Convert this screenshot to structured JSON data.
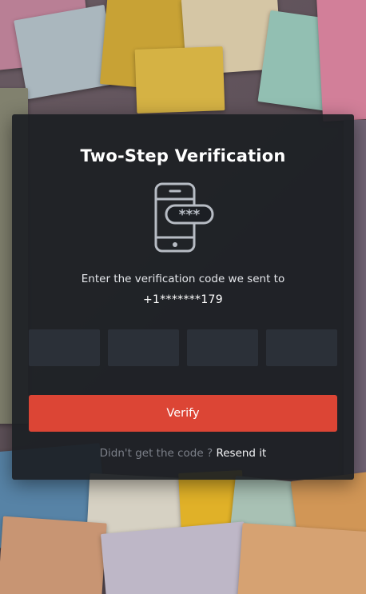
{
  "dialog": {
    "title": "Two-Step Verification",
    "phone_icon": "smartphone-password-icon",
    "phone_icon_text": "***",
    "instruction": "Enter the verification code we sent to",
    "phone_number": "+1*******179",
    "code_inputs": [
      {
        "value": "",
        "placeholder": ""
      },
      {
        "value": "",
        "placeholder": ""
      },
      {
        "value": "",
        "placeholder": ""
      },
      {
        "value": "",
        "placeholder": ""
      }
    ],
    "verify_label": "Verify",
    "resend_prompt": "Didn't get the code ?",
    "resend_link": "Resend it"
  },
  "colors": {
    "card_background": "#1c1f24",
    "input_background": "#2b3038",
    "accent": "#dc4535",
    "muted_text": "#7c8089"
  },
  "background": {
    "type": "anime-collage-image"
  }
}
